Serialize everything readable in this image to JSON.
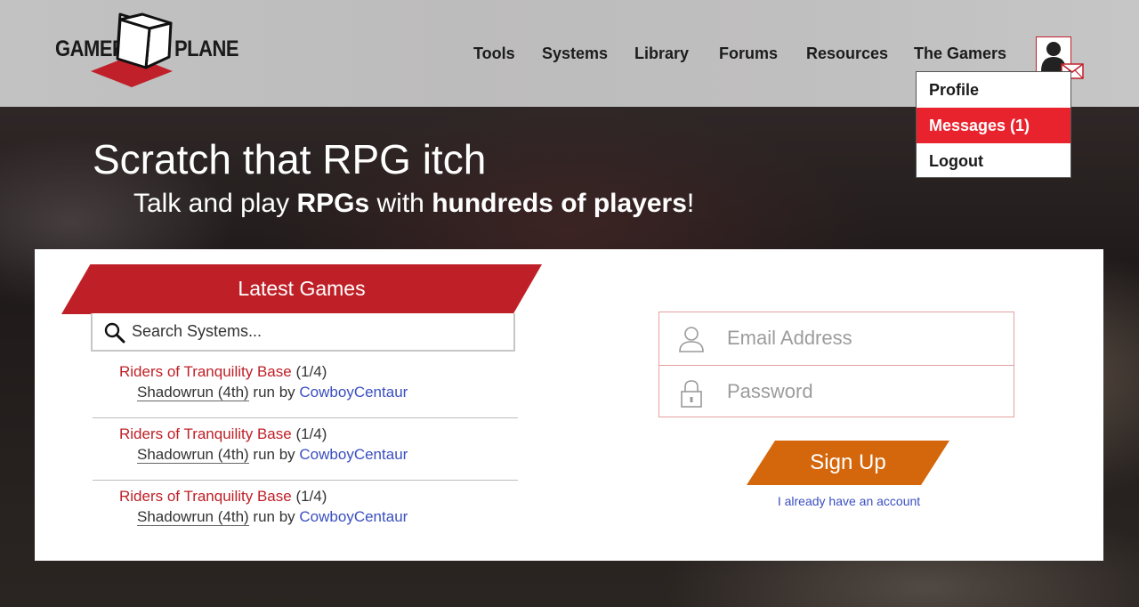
{
  "logo": {
    "left_text": "GAMERS",
    "right_text": "PLANE"
  },
  "nav": {
    "items": [
      {
        "label": "Tools"
      },
      {
        "label": "Systems"
      },
      {
        "label": "Library"
      },
      {
        "label": "Forums"
      },
      {
        "label": "Resources"
      },
      {
        "label": "The Gamers"
      }
    ]
  },
  "user_menu": {
    "items": [
      {
        "label": "Profile"
      },
      {
        "label": "Messages (1)"
      },
      {
        "label": "Logout"
      }
    ],
    "active_item": "Messages (1)"
  },
  "hero": {
    "title": "Scratch that RPG itch",
    "subtitle_part1": "Talk and play ",
    "subtitle_bold1": "RPGs",
    "subtitle_part2": " with ",
    "subtitle_bold2": "hundreds of players",
    "subtitle_part3": "!"
  },
  "latest_games": {
    "heading": "Latest Games",
    "search_placeholder": "Search Systems...",
    "games": [
      {
        "title": "Riders of Tranquility Base",
        "players": "(1/4)",
        "system": "Shadowrun (4th)",
        "run_by": "run by",
        "gm": "CowboyCentaur"
      },
      {
        "title": "Riders of Tranquility Base",
        "players": "(1/4)",
        "system": "Shadowrun (4th)",
        "run_by": "run by",
        "gm": "CowboyCentaur"
      },
      {
        "title": "Riders of Tranquility Base",
        "players": "(1/4)",
        "system": "Shadowrun (4th)",
        "run_by": "run by",
        "gm": "CowboyCentaur"
      }
    ]
  },
  "login": {
    "email_placeholder": "Email Address",
    "password_placeholder": "Password",
    "signup_label": "Sign Up",
    "have_account_label": "I already have an account"
  },
  "colors": {
    "brand_red": "#bf2027",
    "menu_active": "#e8232e",
    "signup_orange": "#d4670c",
    "link_blue": "#3a4fc0"
  }
}
